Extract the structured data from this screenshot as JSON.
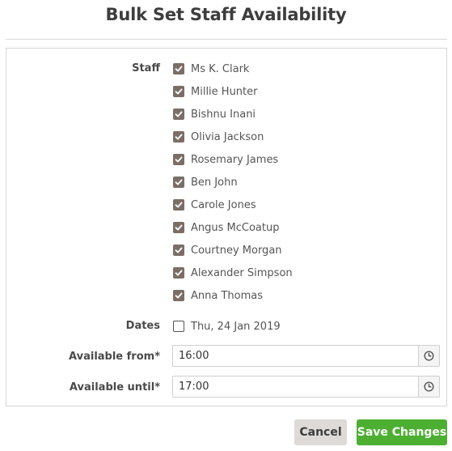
{
  "dialog": {
    "title": "Bulk Set Staff Availability"
  },
  "form": {
    "staff_label": "Staff",
    "staff": [
      {
        "name": "Ms K. Clark",
        "checked": true
      },
      {
        "name": "Millie Hunter",
        "checked": true
      },
      {
        "name": "Bishnu Inani",
        "checked": true
      },
      {
        "name": "Olivia Jackson",
        "checked": true
      },
      {
        "name": "Rosemary James",
        "checked": true
      },
      {
        "name": "Ben John",
        "checked": true
      },
      {
        "name": "Carole Jones",
        "checked": true
      },
      {
        "name": "Angus McCoatup",
        "checked": true
      },
      {
        "name": "Courtney Morgan",
        "checked": true
      },
      {
        "name": "Alexander Simpson",
        "checked": true
      },
      {
        "name": "Anna Thomas",
        "checked": true
      }
    ],
    "dates_label": "Dates",
    "dates": [
      {
        "label": "Thu, 24 Jan 2019",
        "checked": false
      }
    ],
    "available_from_label": "Available from*",
    "available_from_value": "16:00",
    "available_until_label": "Available until*",
    "available_until_value": "17:00"
  },
  "footer": {
    "cancel_label": "Cancel",
    "save_label": "Save Changes"
  },
  "colors": {
    "checkbox_checked": "#7a6e66",
    "save_button": "#4caf32",
    "cancel_button": "#dedad8"
  },
  "icons": {
    "checkbox": "checkmark-icon",
    "time_picker": "clock-icon"
  }
}
